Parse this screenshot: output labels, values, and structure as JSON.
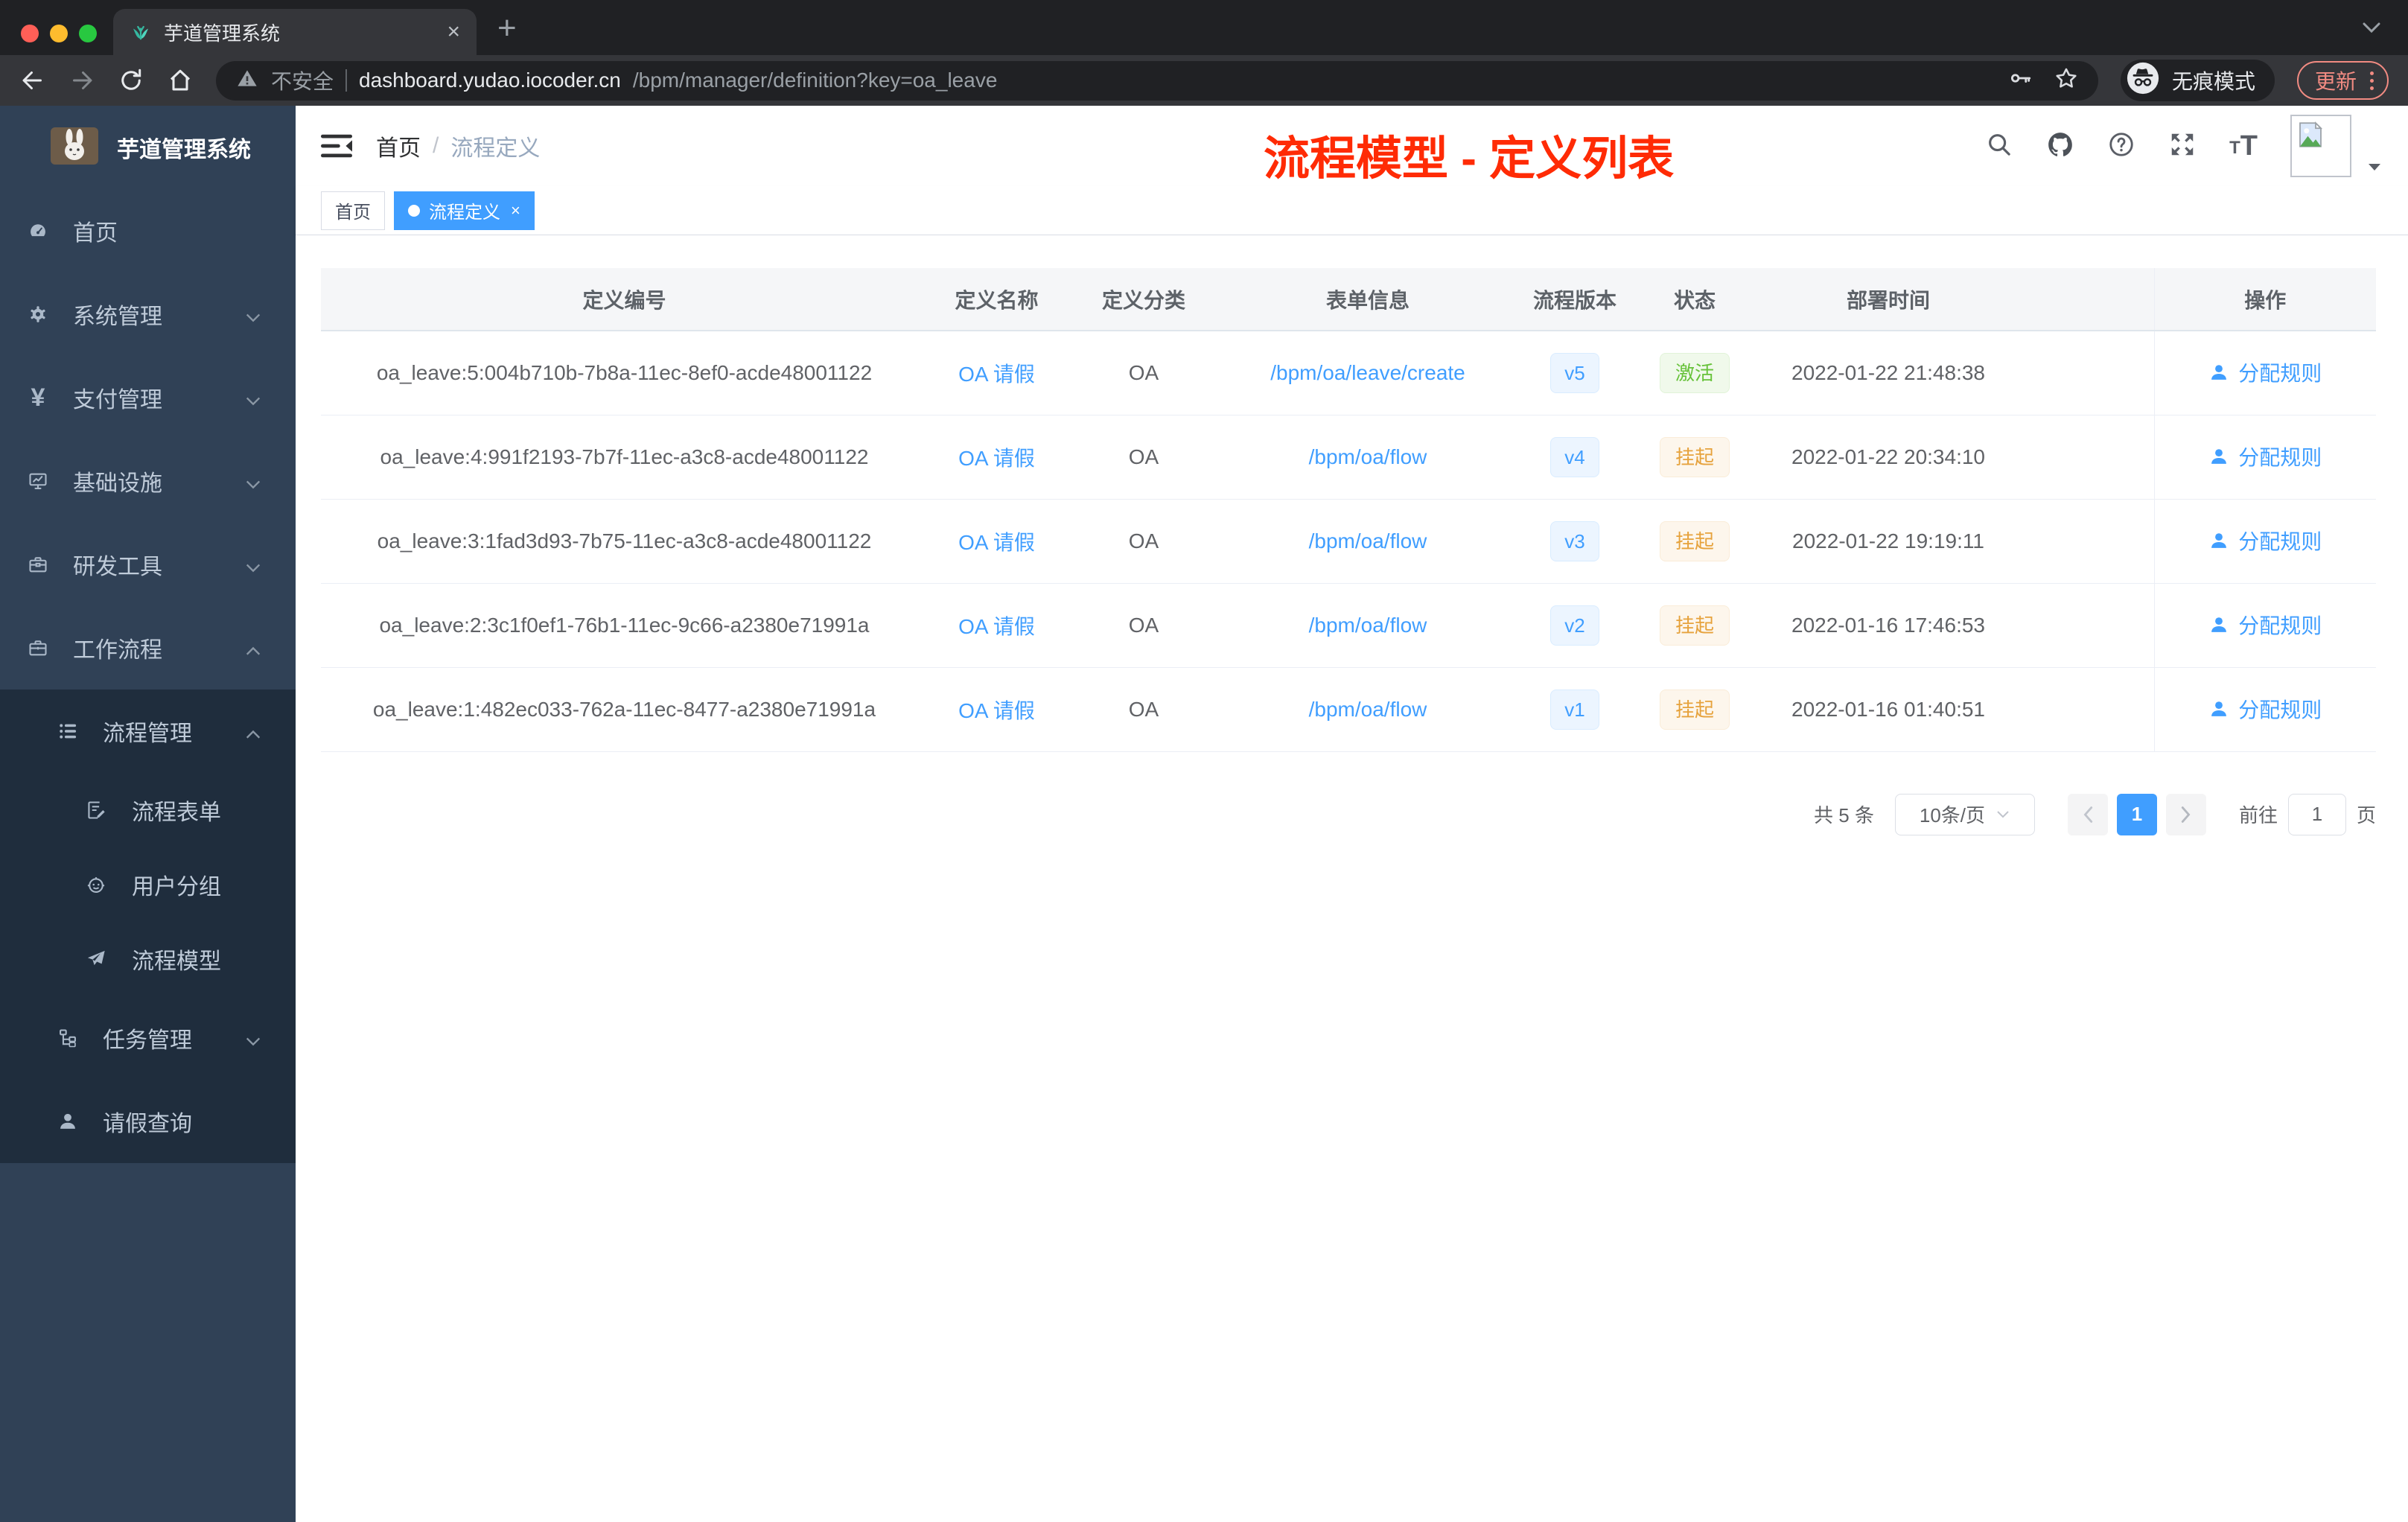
{
  "colors": {
    "accent_blue": "#409eff",
    "success_green": "#67c23a",
    "warning_orange": "#e6a23c",
    "annotation_red": "#ff2b05",
    "sidebar_bg": "#304156",
    "submenu_bg": "#1f2d3d",
    "active_tag_bg": "#409eff",
    "version_tag_bg": "#ecf5ff",
    "status_active_bg": "#f0f9eb",
    "status_suspend_bg": "#fdf6ec"
  },
  "browser": {
    "tab_title": "芋道管理系统",
    "close_tab": "×",
    "new_tab": "+",
    "security_label": "不安全",
    "url_host": "dashboard.yudao.iocoder.cn",
    "url_path": "/bpm/manager/definition?key=oa_leave",
    "incognito_label": "无痕模式",
    "update_label": "更新"
  },
  "sidebar": {
    "logo_title": "芋道管理系统",
    "items": [
      {
        "label": "首页",
        "icon": "dashboard-icon",
        "level": 1
      },
      {
        "label": "系统管理",
        "icon": "gear-icon",
        "level": 1,
        "chevron": "down"
      },
      {
        "label": "支付管理",
        "icon": "yen-icon",
        "level": 1,
        "chevron": "down"
      },
      {
        "label": "基础设施",
        "icon": "monitor-icon",
        "level": 1,
        "chevron": "down"
      },
      {
        "label": "研发工具",
        "icon": "toolbox-icon",
        "level": 1,
        "chevron": "down"
      },
      {
        "label": "工作流程",
        "icon": "suitcase-icon",
        "level": 1,
        "chevron": "up"
      },
      {
        "label": "流程管理",
        "icon": "list-icon",
        "level": 2,
        "chevron": "up"
      },
      {
        "label": "流程表单",
        "icon": "form-icon",
        "level": 3
      },
      {
        "label": "用户分组",
        "icon": "robot-icon",
        "level": 3
      },
      {
        "label": "流程模型",
        "icon": "paper-plane-icon",
        "level": 3
      },
      {
        "label": "任务管理",
        "icon": "tree-icon",
        "level": 2,
        "chevron": "down"
      },
      {
        "label": "请假查询",
        "icon": "user-icon",
        "level": 2
      }
    ]
  },
  "header": {
    "breadcrumb_home": "首页",
    "breadcrumb_separator": "/",
    "breadcrumb_current": "流程定义",
    "overlay_title": "流程模型 - 定义列表"
  },
  "tags": [
    {
      "label": "首页",
      "active": false
    },
    {
      "label": "流程定义",
      "active": true,
      "close": "×"
    }
  ],
  "table": {
    "columns": [
      "定义编号",
      "定义名称",
      "定义分类",
      "表单信息",
      "流程版本",
      "状态",
      "部署时间",
      "操作"
    ],
    "rows": [
      {
        "id": "oa_leave:5:004b710b-7b8a-11ec-8ef0-acde48001122",
        "name": "OA 请假",
        "category": "OA",
        "form": "/bpm/oa/leave/create",
        "version": "v5",
        "status": "激活",
        "status_type": "success",
        "deploy_time": "2022-01-22 21:48:38",
        "action": "分配规则"
      },
      {
        "id": "oa_leave:4:991f2193-7b7f-11ec-a3c8-acde48001122",
        "name": "OA 请假",
        "category": "OA",
        "form": "/bpm/oa/flow",
        "version": "v4",
        "status": "挂起",
        "status_type": "warning",
        "deploy_time": "2022-01-22 20:34:10",
        "action": "分配规则"
      },
      {
        "id": "oa_leave:3:1fad3d93-7b75-11ec-a3c8-acde48001122",
        "name": "OA 请假",
        "category": "OA",
        "form": "/bpm/oa/flow",
        "version": "v3",
        "status": "挂起",
        "status_type": "warning",
        "deploy_time": "2022-01-22 19:19:11",
        "action": "分配规则"
      },
      {
        "id": "oa_leave:2:3c1f0ef1-76b1-11ec-9c66-a2380e71991a",
        "name": "OA 请假",
        "category": "OA",
        "form": "/bpm/oa/flow",
        "version": "v2",
        "status": "挂起",
        "status_type": "warning",
        "deploy_time": "2022-01-16 17:46:53",
        "action": "分配规则"
      },
      {
        "id": "oa_leave:1:482ec033-762a-11ec-8477-a2380e71991a",
        "name": "OA 请假",
        "category": "OA",
        "form": "/bpm/oa/flow",
        "version": "v1",
        "status": "挂起",
        "status_type": "warning",
        "deploy_time": "2022-01-16 01:40:51",
        "action": "分配规则"
      }
    ]
  },
  "pagination": {
    "total": "共 5 条",
    "page_size": "10条/页",
    "current_page": "1",
    "goto_label": "前往",
    "goto_value": "1",
    "unit_label": "页"
  }
}
